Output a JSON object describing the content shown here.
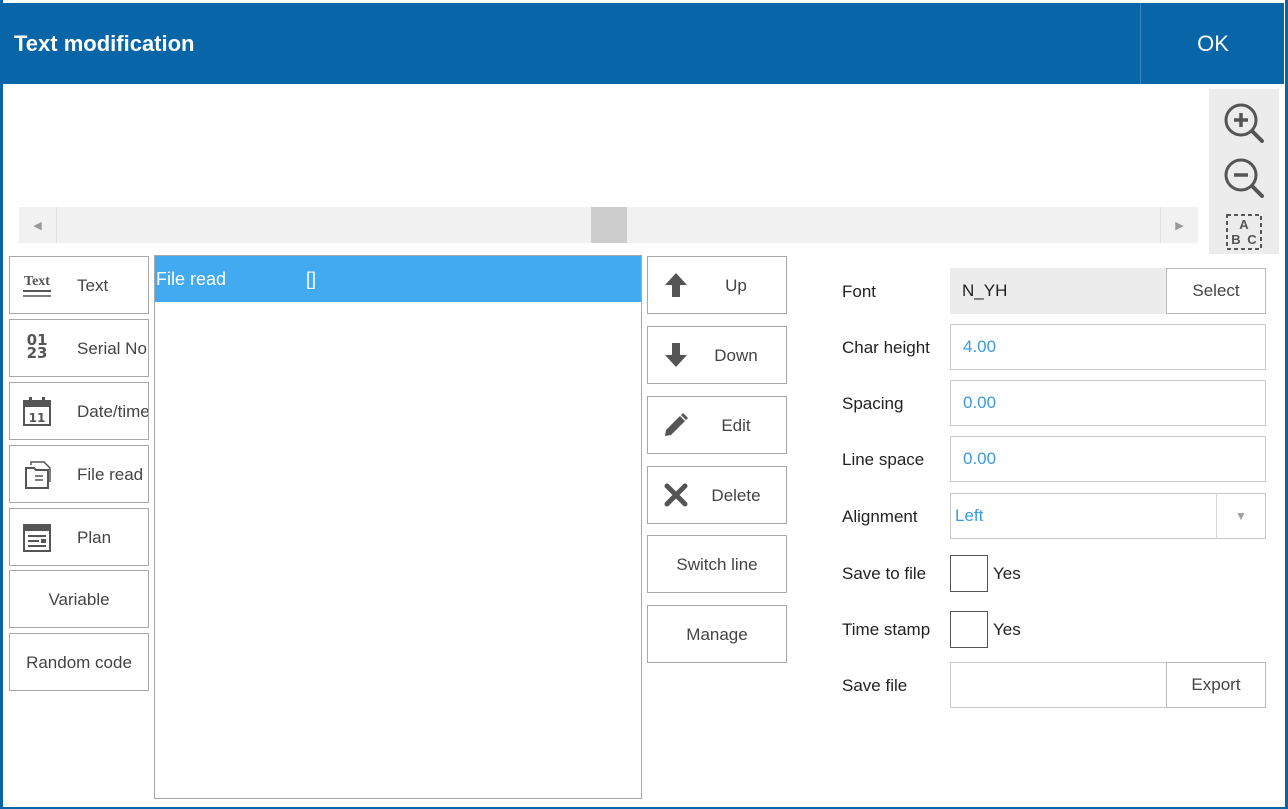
{
  "window": {
    "title": "Text modification",
    "ok_label": "OK"
  },
  "zoom": {
    "zoom_in_icon": "zoom-in-icon",
    "zoom_out_icon": "zoom-out-icon",
    "fit_text_icon": "abc-fit-icon",
    "fit_text_glyphs": [
      "A",
      "B",
      "C"
    ]
  },
  "left_buttons": [
    {
      "label": "Text",
      "icon": "text-icon",
      "icon_text": "Text"
    },
    {
      "label": "Serial No.",
      "icon": "serial-number-icon",
      "icon_text": "01 23"
    },
    {
      "label": "Date/time",
      "icon": "calendar-icon",
      "icon_text": "11"
    },
    {
      "label": "File read",
      "icon": "file-read-icon"
    },
    {
      "label": "Plan",
      "icon": "plan-icon"
    },
    {
      "label": "Variable"
    },
    {
      "label": "Random code"
    }
  ],
  "list": {
    "rows": [
      {
        "name": "File read",
        "value": "[]",
        "selected": true
      }
    ]
  },
  "middle_buttons": [
    {
      "label": "Up",
      "icon": "arrow-up-icon"
    },
    {
      "label": "Down",
      "icon": "arrow-down-icon"
    },
    {
      "label": "Edit",
      "icon": "pencil-icon"
    },
    {
      "label": "Delete",
      "icon": "delete-x-icon"
    },
    {
      "label": "Switch line"
    },
    {
      "label": "Manage"
    }
  ],
  "properties": {
    "font": {
      "label": "Font",
      "value": "N_YH",
      "button": "Select"
    },
    "char_height": {
      "label": "Char height",
      "value": "4.00"
    },
    "spacing": {
      "label": "Spacing",
      "value": "0.00"
    },
    "line_space": {
      "label": "Line space",
      "value": "0.00"
    },
    "alignment": {
      "label": "Alignment",
      "value": "Left"
    },
    "save_to_file": {
      "label": "Save to file",
      "option": "Yes",
      "checked": false
    },
    "time_stamp": {
      "label": "Time stamp",
      "option": "Yes",
      "checked": false
    },
    "save_file": {
      "label": "Save file",
      "value": "",
      "button": "Export"
    }
  },
  "colors": {
    "title_bar": "#0865a8",
    "selection": "#41aaf1",
    "value_text": "#3a9be0"
  }
}
